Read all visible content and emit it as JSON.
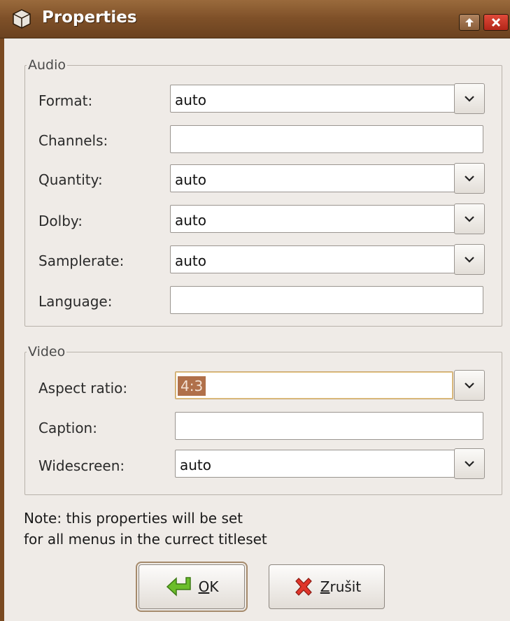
{
  "window": {
    "title": "Properties"
  },
  "audio": {
    "legend": "Audio",
    "format": {
      "label": "Format:",
      "value": "auto"
    },
    "channels": {
      "label": "Channels:",
      "value": ""
    },
    "quantity": {
      "label": "Quantity:",
      "value": "auto"
    },
    "dolby": {
      "label": "Dolby:",
      "value": "auto"
    },
    "samplerate": {
      "label": "Samplerate:",
      "value": "auto"
    },
    "language": {
      "label": "Language:",
      "value": ""
    }
  },
  "video": {
    "legend": "Video",
    "aspect_ratio": {
      "label": "Aspect ratio:",
      "value": "4:3"
    },
    "caption": {
      "label": "Caption:",
      "value": ""
    },
    "widescreen": {
      "label": "Widescreen:",
      "value": "auto"
    }
  },
  "note": {
    "line1": "Note: this properties will be set",
    "line2": "for all menus in the currect titleset"
  },
  "buttons": {
    "ok_mnemonic": "O",
    "ok_rest": "K",
    "cancel_mnemonic": "Z",
    "cancel_rest": "rušit"
  },
  "icons": {
    "window": "package-icon",
    "maximize": "arrow-up-icon",
    "close": "close-icon",
    "ok": "enter-arrow-icon",
    "cancel": "red-x-icon",
    "dropdown": "chevron-down-icon"
  },
  "colors": {
    "titlebar": "#7e5028",
    "background": "#efebe7",
    "selection": "#b0704a"
  }
}
